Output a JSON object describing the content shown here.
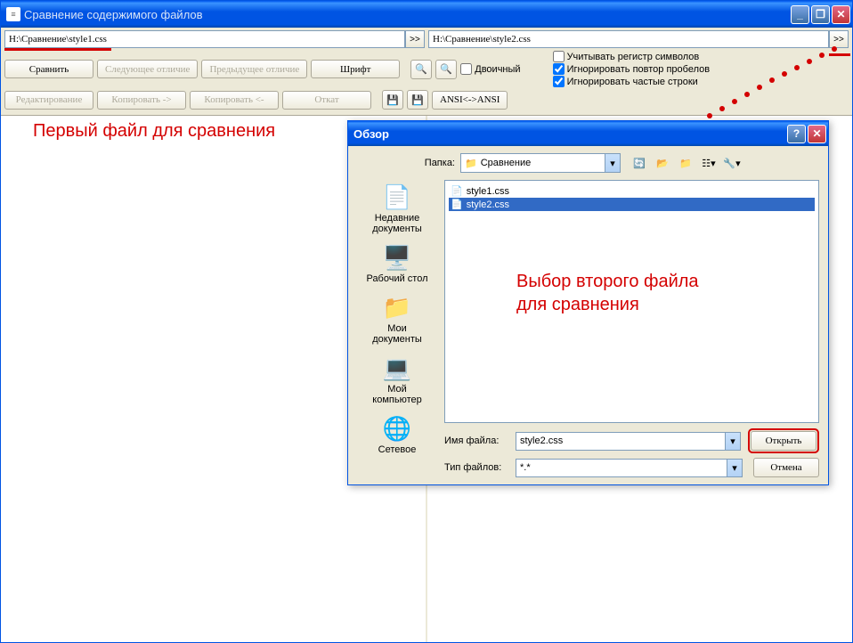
{
  "window": {
    "title": "Сравнение содержимого файлов"
  },
  "path_left": "H:\\Сравнение\\style1.css",
  "path_right": "H:\\Сравнение\\style2.css",
  "toolbar": {
    "compare": "Сравнить",
    "next_diff": "Следующее отличие",
    "prev_diff": "Предыдущее отличие",
    "font": "Шрифт",
    "edit": "Редактирование",
    "copy_right": "Копировать ->",
    "copy_left": "Копировать <-",
    "rollback": "Откат",
    "binary": "Двоичный",
    "ansi": "ANSI<->ANSI"
  },
  "options": {
    "case": "Учитывать регистр символов",
    "spaces": "Игнорировать повтор пробелов",
    "frequent": "Игнорировать частые строки"
  },
  "annotations": {
    "left": "Первый файл для сравнения",
    "right_line1": "Выбор второго файла",
    "right_line2": "для сравнения"
  },
  "dialog": {
    "title": "Обзор",
    "folder_label": "Папка:",
    "folder_value": "Сравнение",
    "sidebar": [
      "Недавние документы",
      "Рабочий стол",
      "Мои документы",
      "Мой компьютер",
      "Сетевое"
    ],
    "files": [
      "style1.css",
      "style2.css"
    ],
    "filename_label": "Имя файла:",
    "filename_value": "style2.css",
    "filetype_label": "Тип файлов:",
    "filetype_value": "*.*",
    "open": "Открыть",
    "cancel": "Отмена"
  }
}
